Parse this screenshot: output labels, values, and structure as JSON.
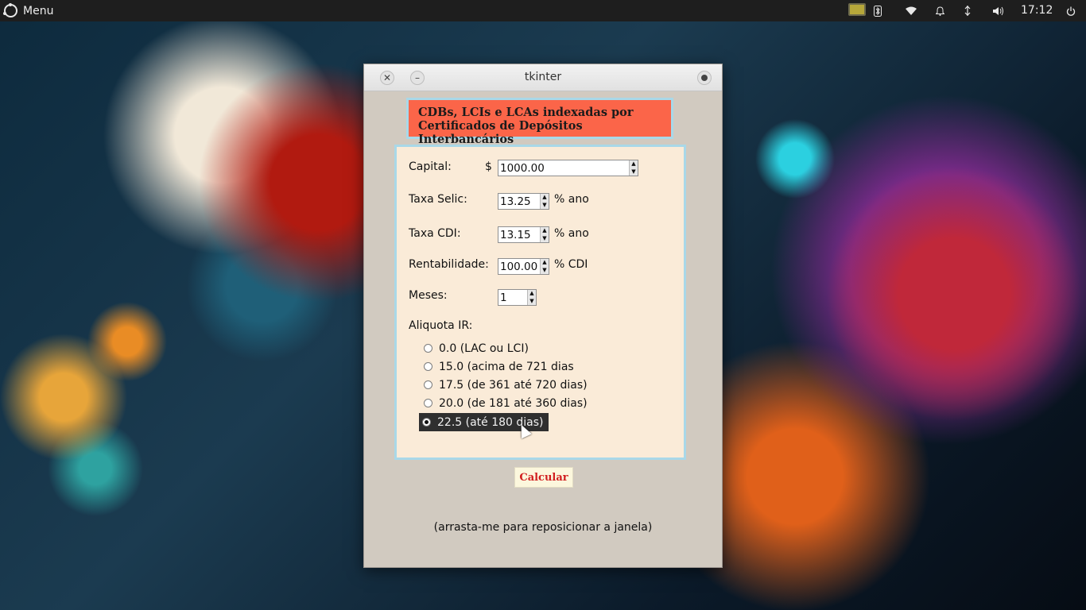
{
  "topbar": {
    "menu_label": "Menu",
    "clock": "17:12",
    "tray_icons": [
      "display-icon",
      "bluetooth-icon",
      "wifi-icon",
      "notification-bell-icon",
      "network-icon",
      "volume-icon",
      "power-icon"
    ]
  },
  "window": {
    "title": "tkinter",
    "header_line1": "CDBs, LCIs e LCAs indexadas por",
    "header_line2": "Certificados de Depósitos Interbancários",
    "fields": {
      "capital": {
        "label": "Capital:",
        "prefix": "$",
        "value": "1000.00"
      },
      "selic": {
        "label": "Taxa Selic:",
        "value": "13.25",
        "unit": "% ano"
      },
      "cdi": {
        "label": "Taxa CDI:",
        "value": "13.15",
        "unit": "% ano"
      },
      "rentabilidade": {
        "label": "Rentabilidade:",
        "value": "100.00",
        "unit": "% CDI"
      },
      "meses": {
        "label": "Meses:",
        "value": "1"
      }
    },
    "aliquota": {
      "label": "Aliquota IR:",
      "options": [
        "0.0 (LAC ou LCI)",
        "15.0 (acima de 721 dias",
        "17.5 (de 361 até 720 dias)",
        "20.0 (de 181 até 360 dias)",
        "22.5 (até 180 dias)"
      ],
      "selected_index": 4
    },
    "calc_button": "Calcular",
    "drag_hint": "(arrasta-me para reposicionar a janela)"
  },
  "colors": {
    "header_bg": "#fb6549",
    "form_bg": "#faebd8",
    "window_bg": "#d1cac0",
    "border_accent": "#a9d8e8",
    "button_text": "#d11f1f"
  }
}
